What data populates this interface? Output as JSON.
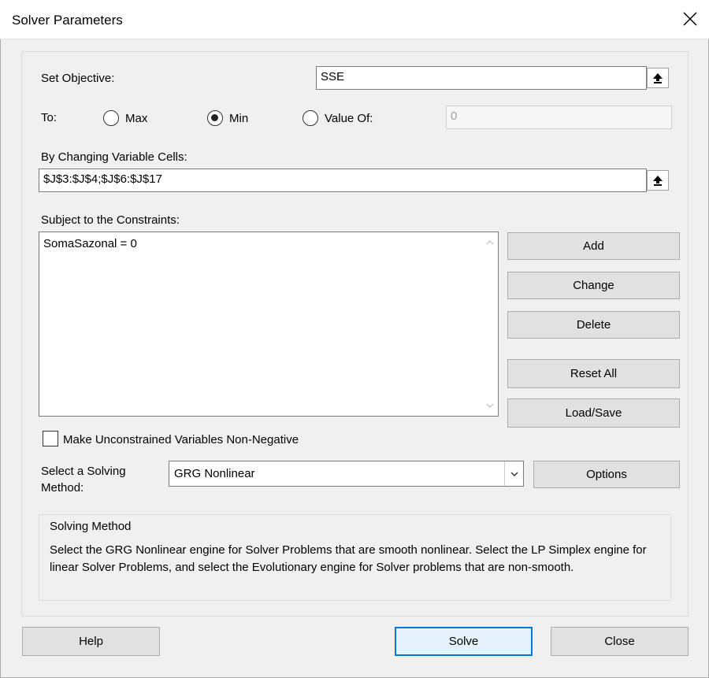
{
  "window": {
    "title": "Solver Parameters"
  },
  "objective": {
    "label": "Set Objective:",
    "value": "SSE"
  },
  "to": {
    "label": "To:",
    "options": [
      {
        "label": "Max",
        "checked": false
      },
      {
        "label": "Min",
        "checked": true
      },
      {
        "label": "Value Of:",
        "checked": false
      }
    ],
    "value_of": "0"
  },
  "variables": {
    "label": "By Changing Variable Cells:",
    "value": "$J$3:$J$4;$J$6:$J$17"
  },
  "constraints": {
    "label": "Subject to the Constraints:",
    "items": [
      "SomaSazonal = 0"
    ],
    "buttons": {
      "add": "Add",
      "change": "Change",
      "delete": "Delete",
      "reset_all": "Reset All",
      "load_save": "Load/Save"
    }
  },
  "nonneg": {
    "label": "Make Unconstrained Variables Non-Negative",
    "checked": false
  },
  "method": {
    "label_line1": "Select a Solving",
    "label_line2": "Method:",
    "selected": "GRG Nonlinear",
    "options_button": "Options"
  },
  "solving_method_box": {
    "title": "Solving Method",
    "text": "Select the GRG Nonlinear engine for Solver Problems that are smooth nonlinear. Select the LP Simplex engine for linear Solver Problems, and select the Evolutionary engine for Solver problems that are non-smooth."
  },
  "footer": {
    "help": "Help",
    "solve": "Solve",
    "close": "Close"
  },
  "colors": {
    "accent": "#0078d7",
    "dialog_bg": "#f0f0f0",
    "button_bg": "#e1e1e1"
  }
}
